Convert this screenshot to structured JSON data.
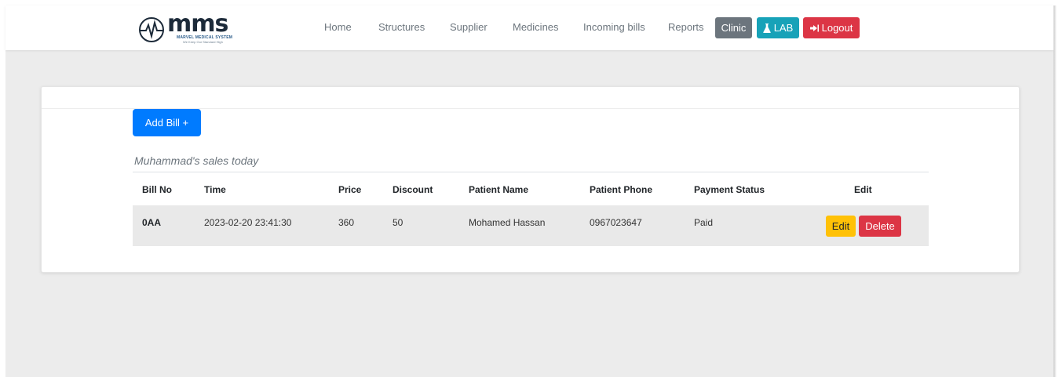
{
  "brand": {
    "name": "mms",
    "subtitle": "MARVEL MEDICAL SYSTEM",
    "tagline": "We Keep Our Standard High"
  },
  "nav": {
    "links": [
      "Home",
      "Structures",
      "Supplier",
      "Medicines",
      "Incoming bills",
      "Reports"
    ],
    "clinic_label": "Clinic",
    "lab_label": "LAB",
    "logout_label": "Logout"
  },
  "colors": {
    "clinic": "#6c757d",
    "lab": "#17a2b8",
    "logout": "#dc3545",
    "add_bill": "#007bff",
    "edit": "#ffc107",
    "delete": "#dc3545"
  },
  "main": {
    "add_bill_label": "Add Bill +",
    "sales_title": "Muhammad's sales today",
    "table": {
      "headers": [
        "Bill No",
        "Time",
        "Price",
        "Discount",
        "Patient Name",
        "Patient Phone",
        "Payment Status",
        "Edit"
      ],
      "rows": [
        {
          "bill_no": "0AA",
          "time": "2023-02-20 23:41:30",
          "price": "360",
          "discount": "50",
          "patient_name": "Mohamed Hassan",
          "patient_phone": "0967023647",
          "payment_status": "Paid",
          "edit_label": "Edit",
          "delete_label": "Delete"
        }
      ]
    }
  }
}
